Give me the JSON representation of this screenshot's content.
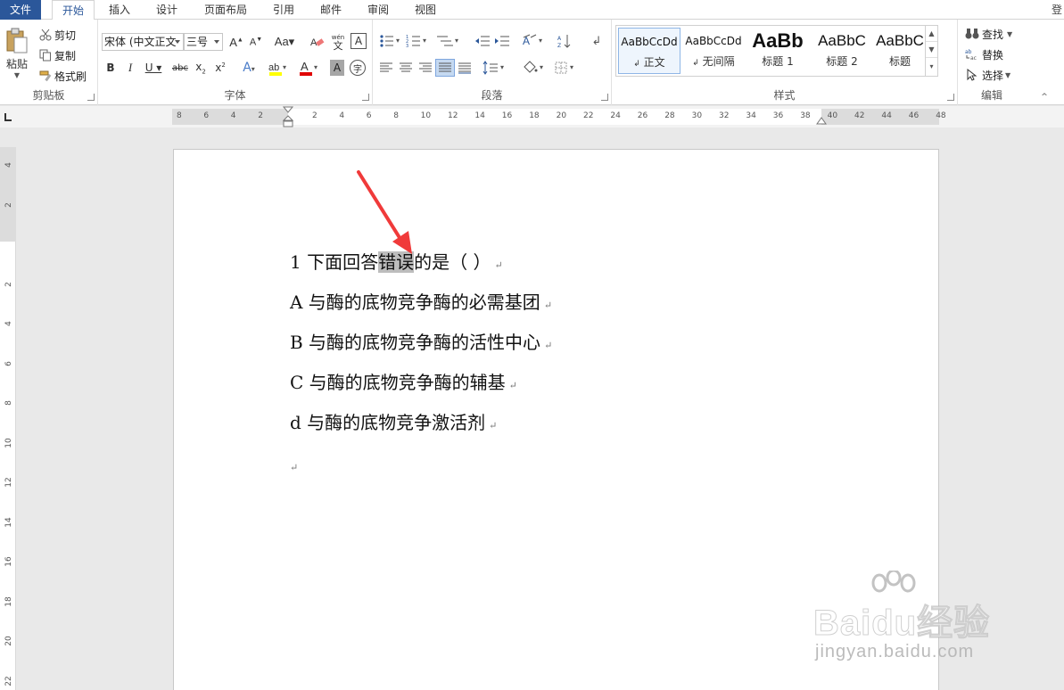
{
  "tabs": {
    "file": "文件",
    "items": [
      "开始",
      "插入",
      "设计",
      "页面布局",
      "引用",
      "邮件",
      "审阅",
      "视图"
    ],
    "right_label": "登"
  },
  "ribbon": {
    "clipboard": {
      "label": "剪贴板",
      "paste": "粘贴",
      "cut": "剪切",
      "copy": "复制",
      "format_painter": "格式刷"
    },
    "font": {
      "label": "字体",
      "font_name": "宋体 (中文正文",
      "font_size": "三号",
      "wen_label": "wén",
      "wen_char": "文",
      "bordered_char": "A",
      "enclosed_char": "字"
    },
    "paragraph": {
      "label": "段落"
    },
    "styles": {
      "label": "样式",
      "items": [
        {
          "sample": "AaBbCcDd",
          "name": "正文",
          "mark": "↲"
        },
        {
          "sample": "AaBbCcDd",
          "name": "无间隔",
          "mark": "↲"
        },
        {
          "sample": "AaBb",
          "name": "标题 1",
          "mark": ""
        },
        {
          "sample": "AaBbC",
          "name": "标题 2",
          "mark": ""
        },
        {
          "sample": "AaBbC",
          "name": "标题",
          "mark": ""
        }
      ]
    },
    "editing": {
      "label": "编辑",
      "find": "查找",
      "replace": "替换",
      "select": "选择"
    }
  },
  "ruler": {
    "numbers": [
      "8",
      "6",
      "4",
      "2",
      "",
      "2",
      "4",
      "6",
      "8",
      "10",
      "12",
      "14",
      "16",
      "18",
      "20",
      "22",
      "24",
      "26",
      "28",
      "30",
      "32",
      "34",
      "36",
      "38",
      "40",
      "42",
      "44",
      "46",
      "48"
    ]
  },
  "vruler": {
    "numbers": [
      "4",
      "2",
      "",
      "2",
      "4",
      "6",
      "8",
      "10",
      "12",
      "14",
      "16",
      "18",
      "20",
      "22"
    ]
  },
  "document": {
    "question": {
      "prefix": "1 下面回答",
      "highlighted": "错误",
      "suffix": "的是（    ）"
    },
    "options": [
      "A 与酶的底物竞争酶的必需基团",
      "B 与酶的底物竞争酶的活性中心",
      "C 与酶的底物竞争酶的辅基",
      "d 与酶的底物竞争激活剂"
    ],
    "para_mark": "↵"
  },
  "watermark": {
    "brand": "Baidu经验",
    "url": "jingyan.baidu.com"
  }
}
